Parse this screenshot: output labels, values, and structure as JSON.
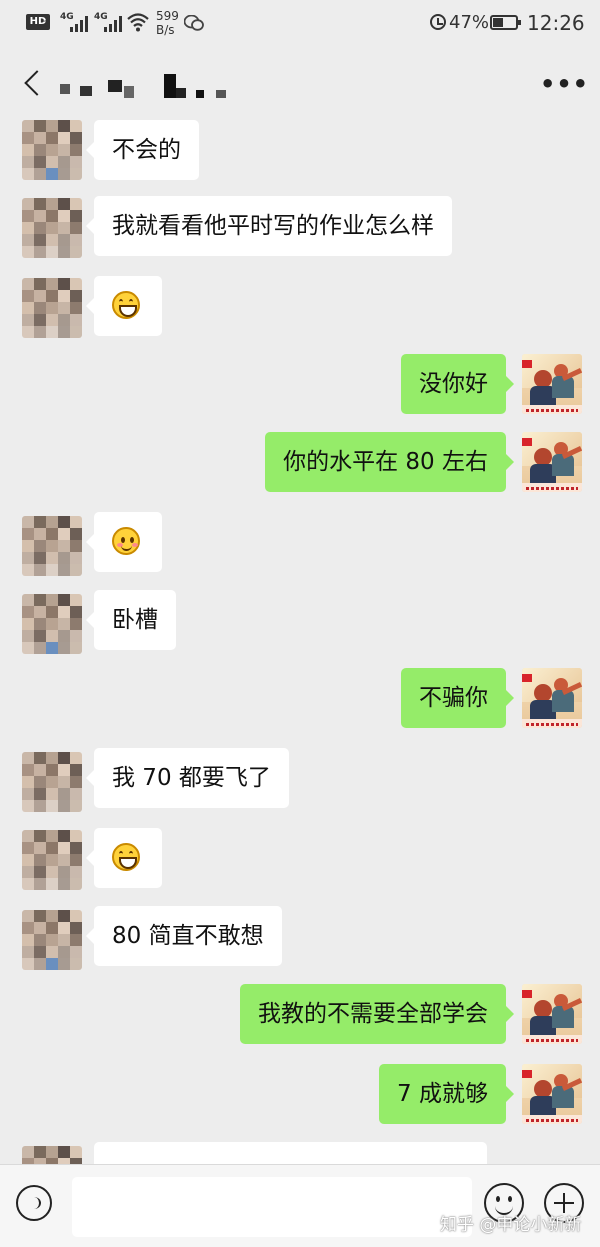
{
  "status_bar": {
    "hd_label": "HD",
    "hd_sub": "2",
    "network_1": "4G",
    "network_2": "4G",
    "speed_value": "599",
    "speed_unit": "B/s",
    "battery_percent": "47%",
    "battery_level": 0.47,
    "time": "12:26"
  },
  "nav": {
    "more_label": "•••"
  },
  "messages": [
    {
      "side": "in",
      "text": "不会的"
    },
    {
      "side": "in",
      "text": "我就看看他平时写的作业怎么样"
    },
    {
      "side": "in",
      "emoji": "grin-emoji"
    },
    {
      "side": "out",
      "text": "没你好"
    },
    {
      "side": "out",
      "text": "你的水平在 80 左右"
    },
    {
      "side": "in",
      "emoji": "smile-emoji"
    },
    {
      "side": "in",
      "text": "卧槽"
    },
    {
      "side": "out",
      "text": "不骗你"
    },
    {
      "side": "in",
      "text": "我 70 都要飞了"
    },
    {
      "side": "in",
      "emoji": "grin-emoji"
    },
    {
      "side": "in",
      "text": "80 简直不敢想"
    },
    {
      "side": "out",
      "text": "我教的不需要全部学会"
    },
    {
      "side": "out",
      "text": "7 成就够"
    },
    {
      "side": "in",
      "text": ""
    }
  ],
  "input_bar": {
    "placeholder": ""
  },
  "watermark": "知乎 @申论小新新",
  "colors": {
    "background": "#ededed",
    "incoming_bubble": "#ffffff",
    "outgoing_bubble": "#95ec69",
    "text": "#111111"
  }
}
